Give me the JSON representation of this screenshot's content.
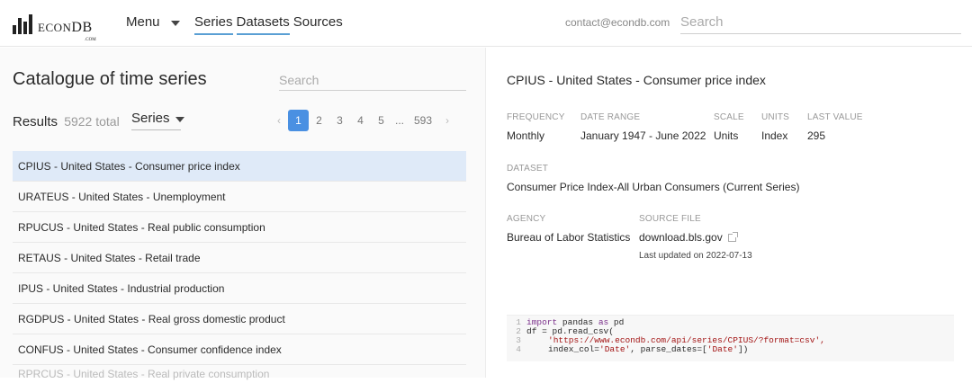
{
  "brand": {
    "name_prefix": "ECON",
    "name_suffix": "DB",
    "domain": ".COM"
  },
  "nav": {
    "menu_label": "Menu",
    "links": [
      "Series",
      "Datasets",
      "Sources"
    ],
    "contact": "contact@econdb.com",
    "search_placeholder": "Search"
  },
  "catalogue": {
    "title": "Catalogue of time series",
    "search_placeholder": "Search",
    "results_label": "Results",
    "results_total": "5922 total",
    "filter_label": "Series",
    "pagination": {
      "pages": [
        "1",
        "2",
        "3",
        "4",
        "5"
      ],
      "ellipsis": "...",
      "last": "593",
      "active": "1",
      "prev": "‹",
      "next": "›"
    },
    "rows": [
      "CPIUS - United States - Consumer price index",
      "URATEUS - United States - Unemployment",
      "RPUCUS - United States - Real public consumption",
      "RETAUS - United States - Retail trade",
      "IPUS - United States - Industrial production",
      "RGDPUS - United States - Real gross domestic product",
      "CONFUS - United States - Consumer confidence index"
    ],
    "partial_row": "RPRCUS - United States - Real private consumption"
  },
  "detail": {
    "title": "CPIUS - United States - Consumer price index",
    "frequency_label": "FREQUENCY",
    "frequency": "Monthly",
    "range_label": "DATE RANGE",
    "range": "January 1947 - June 2022",
    "scale_label": "SCALE",
    "scale": "Units",
    "units_label": "UNITS",
    "units": "Index",
    "last_label": "LAST VALUE",
    "last": "295",
    "dataset_label": "DATASET",
    "dataset": "Consumer Price Index-All Urban Consumers (Current Series)",
    "agency_label": "AGENCY",
    "agency": "Bureau of Labor Statistics",
    "source_label": "SOURCE FILE",
    "source": "download.bls.gov",
    "updated": "Last updated on 2022-07-13",
    "code": {
      "l1_kw": "import",
      "l1_rest": " pandas ",
      "l1_kw2": "as",
      "l1_end": " pd",
      "l2": "df = pd.read_csv(",
      "l3": "'https://www.econdb.com/api/series/CPIUS/?format=csv',",
      "l4_a": "index_col=",
      "l4_b": "'Date'",
      "l4_c": ", parse_dates=[",
      "l4_d": "'Date'",
      "l4_e": "])"
    }
  },
  "colors": {
    "accent": "#4a90e2",
    "selected_row": "#dfeaf8",
    "nav_underline": "#5a9fd4"
  }
}
